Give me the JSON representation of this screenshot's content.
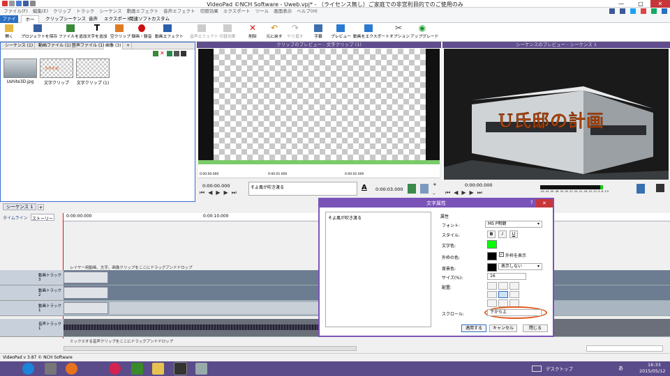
{
  "window": {
    "title": "VideoPad ©NCH Software - Uweb.vpj* - （ライセンス無し）ご家庭での非営利目的でのご使用のみ",
    "controls": [
      "—",
      "□",
      "✕"
    ]
  },
  "menu": [
    "ファイル(F)",
    "編集(E)",
    "クリップ",
    "トラック",
    "シーケンス",
    "動画エフェクト",
    "音声エフェクト",
    "切替効果",
    "エクスポート",
    "ツール",
    "画面表示",
    "ヘルプ(H)"
  ],
  "ribbon_tabs": [
    "ファイル",
    "ホーム",
    "クリップ",
    "シーケンス",
    "音声",
    "エクスポート",
    "関連ソフト",
    "カスタム"
  ],
  "ribbon_buttons": [
    "開く",
    "プロジェクトを保存",
    "ファイルを追加",
    "文字を追加",
    "空クリップ",
    "録画・録音",
    "動画エフェクト",
    "音声エフェクト",
    "切替効果",
    "削除",
    "元に戻す",
    "やり直す",
    "字幕",
    "プレビュー",
    "動画をエクスポート",
    "オプション",
    "アップグレード"
  ],
  "colors": {
    "accent": "#2b6fc3",
    "dialog": "#7a53b8",
    "preview_header": "#5f4d8e",
    "taskbar": "#5a4b8a",
    "scroll_highlight": "#e05a1c",
    "text_color_swatch": "#00ff00"
  },
  "bin": {
    "tabs": [
      "シーケンス",
      "(1)",
      "動画ファイル",
      "(1)",
      "音声ファイル",
      "(1)",
      "画像",
      "(3)",
      "+"
    ],
    "items": [
      "Ushite3D.jpg",
      "文字クリップ",
      "文字クリップ (1)"
    ],
    "thumb_caption": "文字を追"
  },
  "clip_preview": {
    "title": "クリップのプレビュー - 文字クリップ (1)",
    "time": "0:00:00.000",
    "ruler": [
      "0:00:00.000",
      "0:00:01.000",
      "0:00:02.000"
    ],
    "text_field": "そよ風が吹き渡る",
    "duration": "0:00:03.000",
    "zoom_plus": "+",
    "zoom_minus": "–"
  },
  "seq_preview": {
    "title": "シーケンスのプレビュー - シーケンス 1",
    "time": "0:00:00.000",
    "overlay_text": "U氏邸の計画",
    "meter": "-45 -42 -39 -36 -33 -30 -27 -24 -21 -18 -15 -12 -9 -6 -3 0"
  },
  "timeline": {
    "sequence_tab": "シーケンス 1",
    "add_tab": "+",
    "view_tabs": [
      "タイムライン",
      "ストーリーボード"
    ],
    "time_start": "0:00:00.000",
    "time_mid": "0:00:10.000",
    "hint_video": "レイヤー用動画、文字、画像クリップをここにドラッグアンドドロップ",
    "hint_audio": "ミックスする音声クリップをここにドラッグアンドドロップ",
    "tracks": [
      "動画トラック 3",
      "動画トラック 2",
      "動画トラック 1",
      "音声トラック 1"
    ]
  },
  "dialog": {
    "title": "文字属性",
    "help": "?",
    "close": "✕",
    "text": "そよ風が吹き渡る",
    "section": "属性",
    "font_label": "フォント:",
    "font_value": "MS P明朝",
    "style_label": "スタイル:",
    "style_buttons": [
      "B",
      "I",
      "U"
    ],
    "color_label": "文字色:",
    "outline_label": "外枠の色:",
    "outline_check": "外枠を表示",
    "bg_label": "背景色:",
    "bg_value": "表示しない",
    "size_label": "サイズ(%):",
    "size_value": "16",
    "align_label": "配置:",
    "scroll_label": "スクロール:",
    "scroll_value": "下から上",
    "buttons": [
      "適用する",
      "キャンセル",
      "閉じる"
    ]
  },
  "status": "VideoPad v 3.87 © NCH Software",
  "taskbar": {
    "desktop": "デスクトップ",
    "ime": "あ",
    "time": "16:33",
    "date": "2015/05/12"
  }
}
